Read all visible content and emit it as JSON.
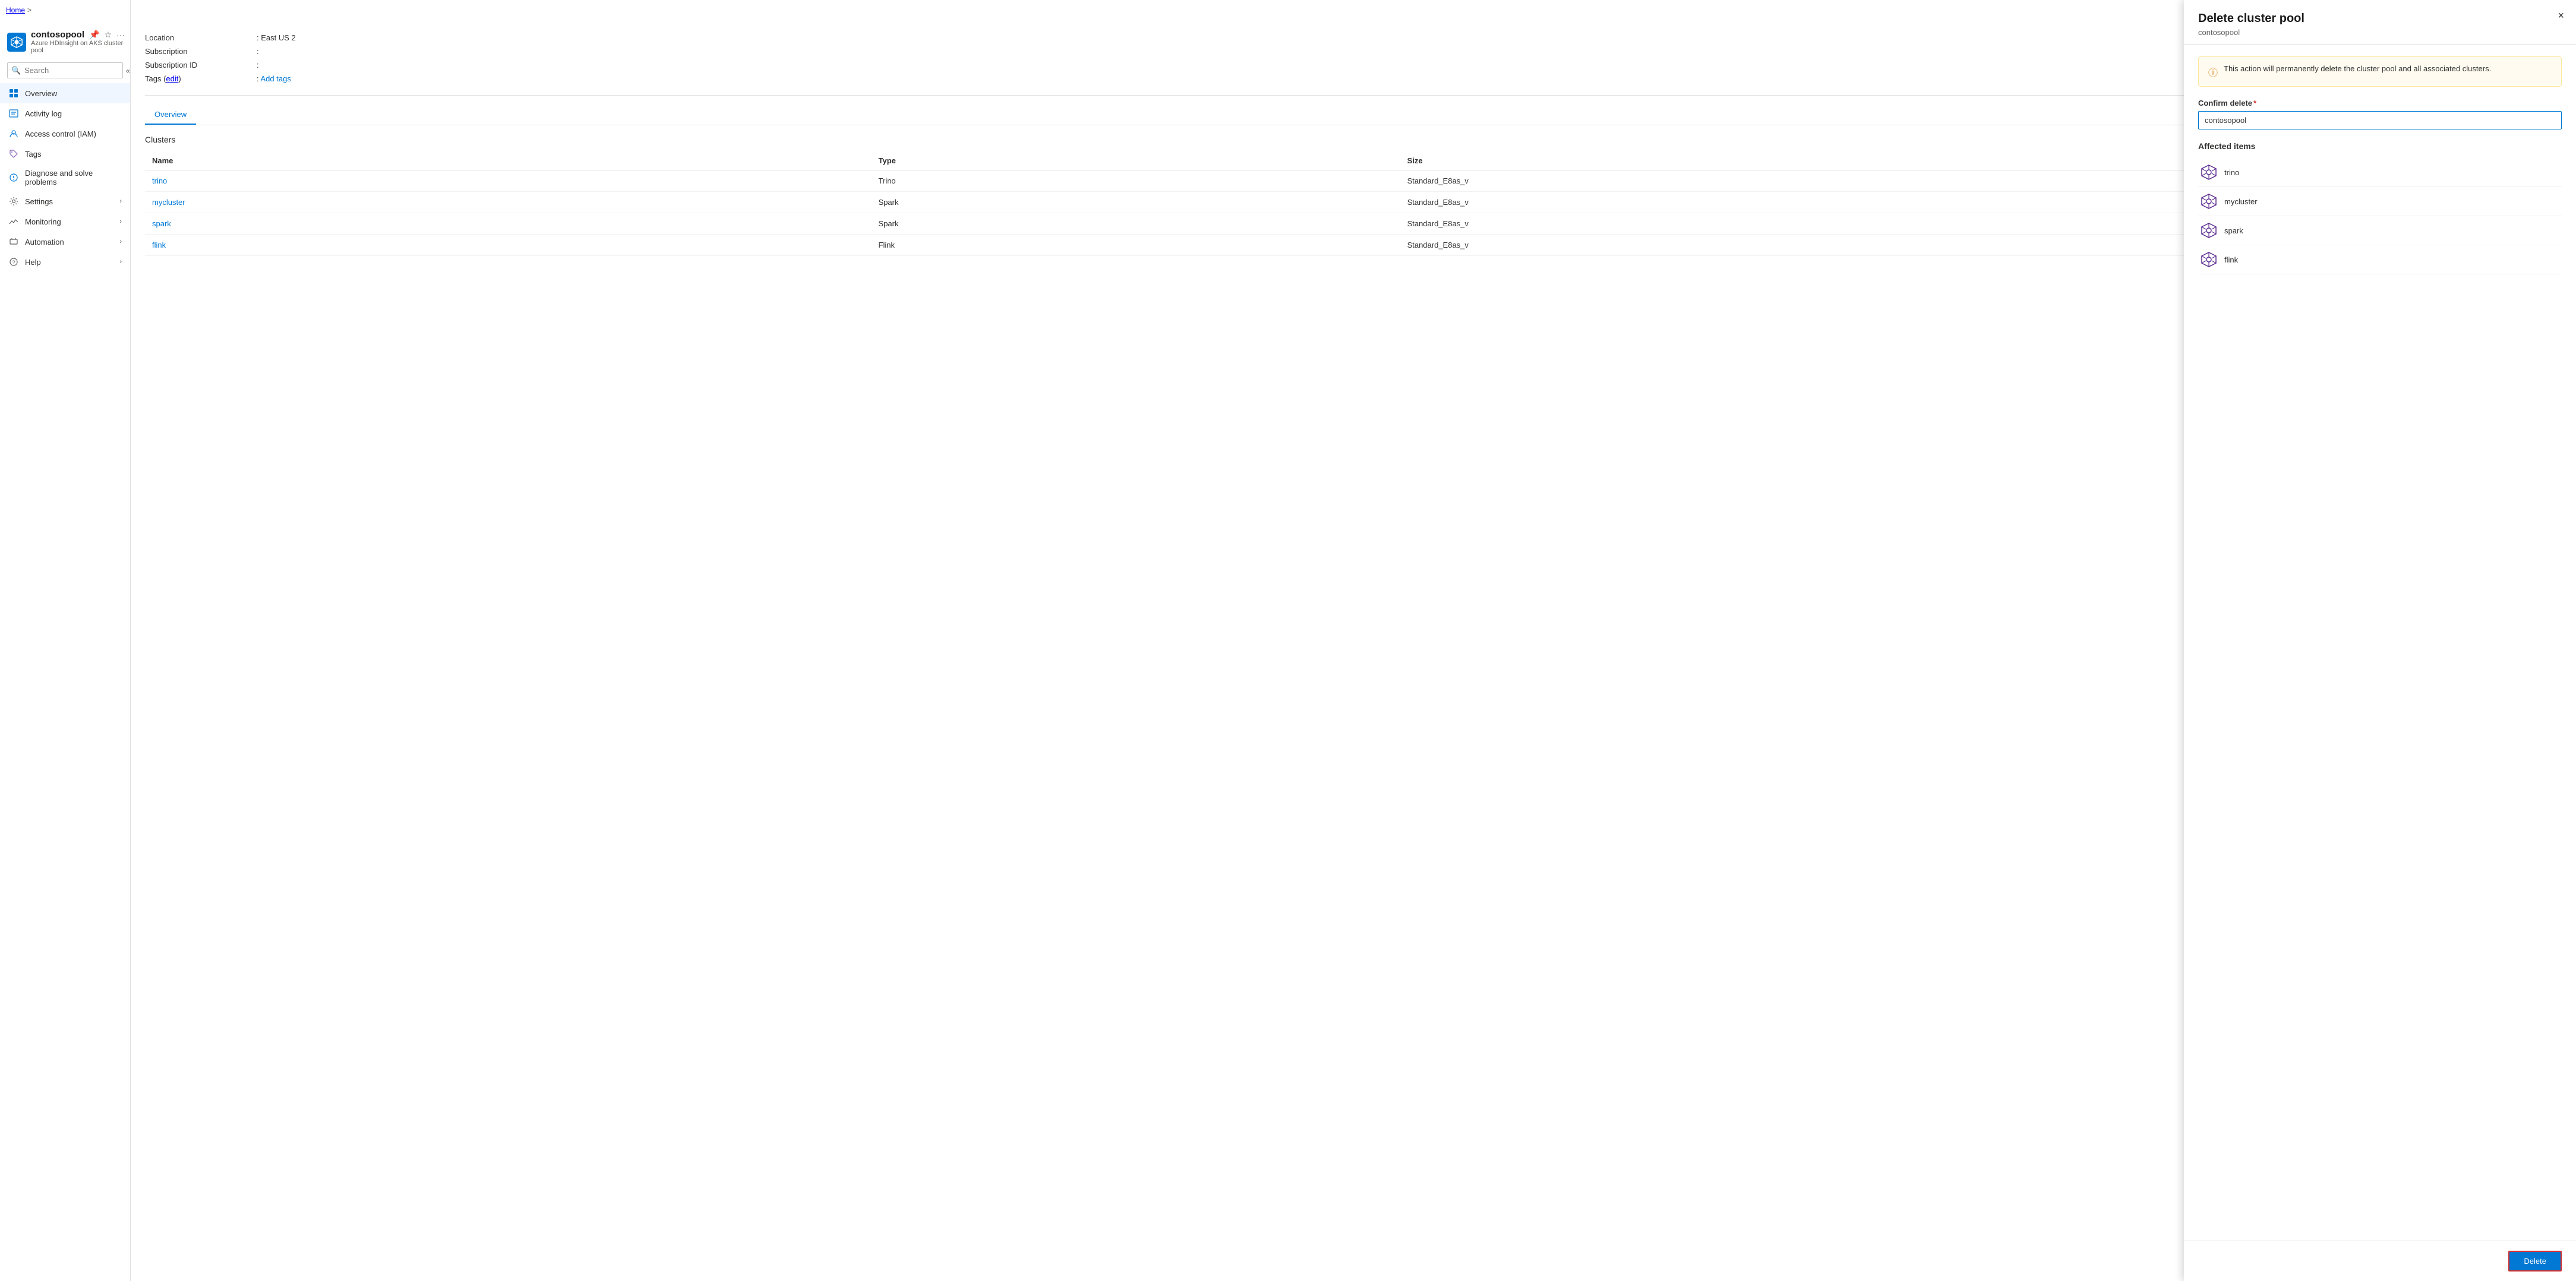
{
  "breadcrumb": {
    "home_label": "Home",
    "separator": ">"
  },
  "sidebar": {
    "title": "contosopool",
    "subtitle": "Azure HDInsight on AKS cluster pool",
    "search_placeholder": "Search",
    "nav_items": [
      {
        "id": "overview",
        "label": "Overview",
        "icon": "overview-icon",
        "active": true,
        "expandable": false
      },
      {
        "id": "activity-log",
        "label": "Activity log",
        "icon": "activity-icon",
        "active": false,
        "expandable": false
      },
      {
        "id": "access-control",
        "label": "Access control (IAM)",
        "icon": "iam-icon",
        "active": false,
        "expandable": false
      },
      {
        "id": "tags",
        "label": "Tags",
        "icon": "tags-icon",
        "active": false,
        "expandable": false
      },
      {
        "id": "diagnose",
        "label": "Diagnose and solve problems",
        "icon": "diagnose-icon",
        "active": false,
        "expandable": false
      },
      {
        "id": "settings",
        "label": "Settings",
        "icon": "settings-icon",
        "active": false,
        "expandable": true
      },
      {
        "id": "monitoring",
        "label": "Monitoring",
        "icon": "monitoring-icon",
        "active": false,
        "expandable": true
      },
      {
        "id": "automation",
        "label": "Automation",
        "icon": "automation-icon",
        "active": false,
        "expandable": true
      },
      {
        "id": "help",
        "label": "Help",
        "icon": "help-icon",
        "active": false,
        "expandable": true
      }
    ]
  },
  "main": {
    "resource": {
      "location_label": "Location",
      "location_value": ": East US 2",
      "subscription_label": "Subscription",
      "subscription_value": ":",
      "subscription_id_label": "Subscription ID",
      "subscription_id_value": ":",
      "tags_label": "Tags (edit)",
      "tags_value": ": Add tags"
    },
    "tabs": [
      {
        "id": "overview",
        "label": "Overview",
        "active": true
      }
    ],
    "clusters_label": "Clusters",
    "table_headers": [
      "Name",
      "Type",
      "Size"
    ],
    "table_rows": [
      {
        "name": "trino",
        "type": "Trino",
        "size": "Standard_E8as_v"
      },
      {
        "name": "mycluster",
        "type": "Spark",
        "size": "Standard_E8as_v"
      },
      {
        "name": "spark",
        "type": "Spark",
        "size": "Standard_E8as_v"
      },
      {
        "name": "flink",
        "type": "Flink",
        "size": "Standard_E8as_v"
      }
    ]
  },
  "panel": {
    "title": "Delete cluster pool",
    "subtitle": "contosopool",
    "close_label": "×",
    "warning_text": "This action will permanently delete the cluster pool and all associated clusters.",
    "confirm_label": "Confirm delete",
    "confirm_value": "contosopool",
    "confirm_placeholder": "contosopool",
    "affected_label": "Affected items",
    "affected_items": [
      {
        "name": "trino"
      },
      {
        "name": "mycluster"
      },
      {
        "name": "spark"
      },
      {
        "name": "flink"
      }
    ],
    "delete_button_label": "Delete"
  }
}
